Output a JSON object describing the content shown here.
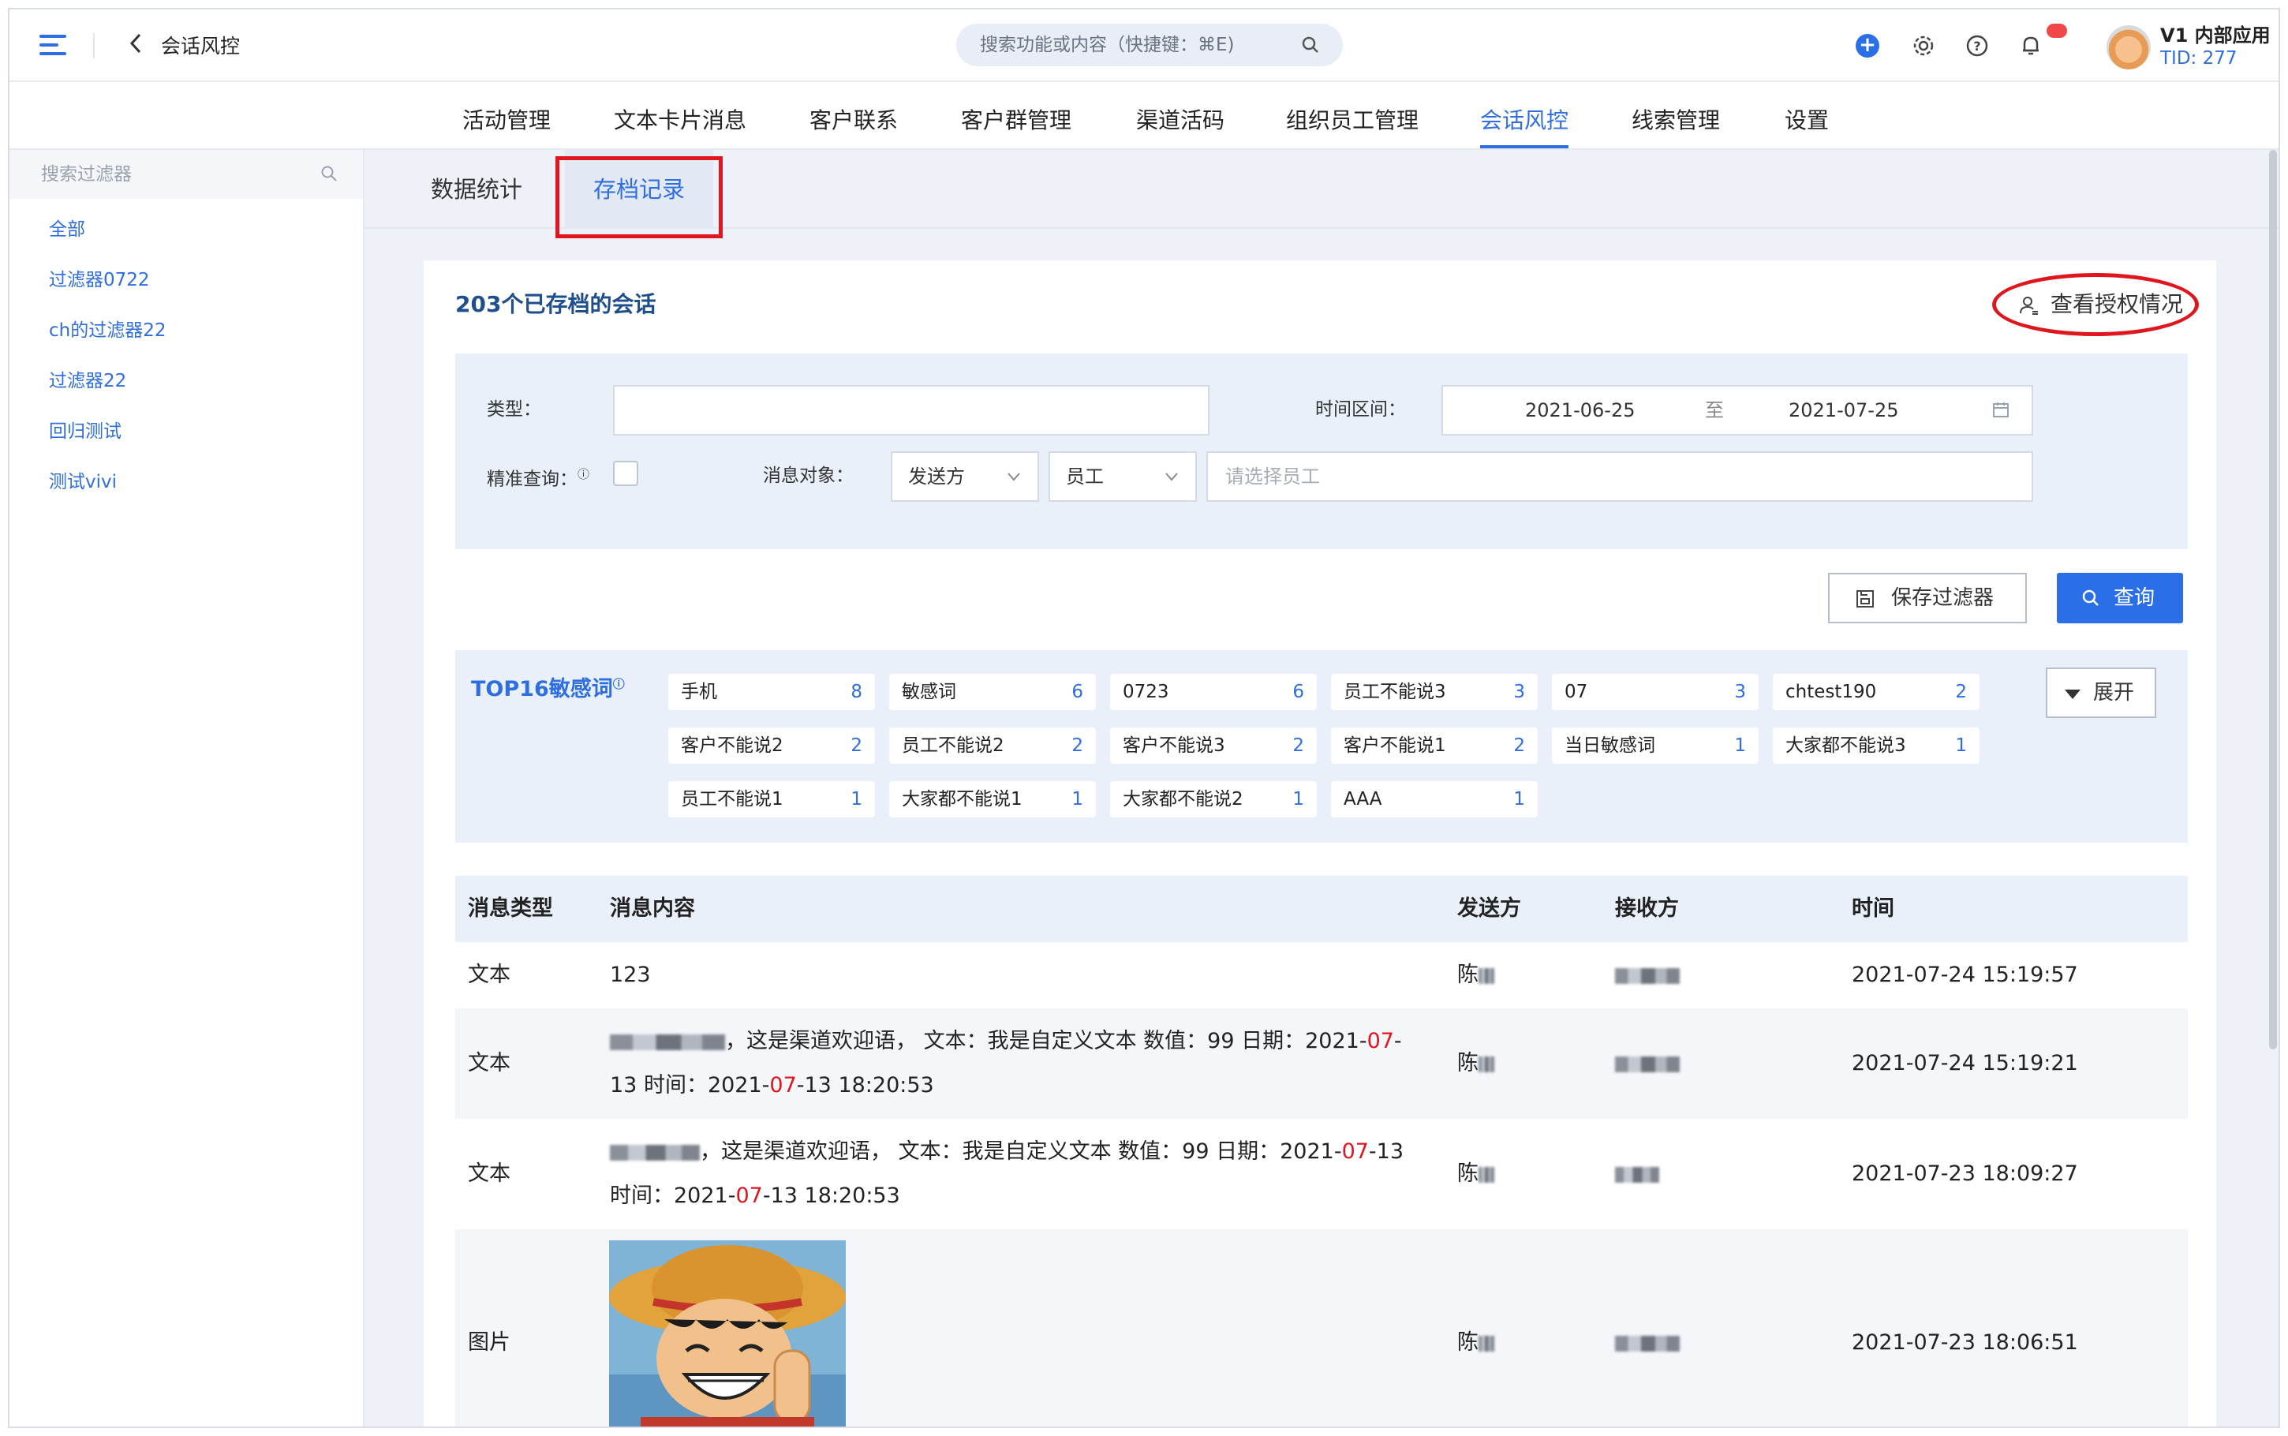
{
  "topbar": {
    "page_title": "会话风控",
    "search_placeholder": "搜索功能或内容（快捷键：⌘E)",
    "app_name": "V1 内部应用",
    "tid": "TID: 277"
  },
  "nav": {
    "items": [
      "活动管理",
      "文本卡片消息",
      "客户联系",
      "客户群管理",
      "渠道活码",
      "组织员工管理",
      "会话风控",
      "线索管理",
      "设置"
    ],
    "active": "会话风控"
  },
  "sidebar": {
    "search_placeholder": "搜索过滤器",
    "items": [
      "全部",
      "过滤器0722",
      "ch的过滤器22",
      "过滤器22",
      "回归测试",
      "测试vivi"
    ]
  },
  "tabs": [
    "数据统计",
    "存档记录"
  ],
  "card": {
    "title": "203个已存档的会话",
    "auth_link": "查看授权情况"
  },
  "filter": {
    "type_label": "类型：",
    "time_label": "时间区间：",
    "start_date": "2021-06-25",
    "range_sep": "至",
    "end_date": "2021-07-25",
    "exact_label": "精准查询：",
    "target_label": "消息对象：",
    "sender_select": "发送方",
    "role_select": "员工",
    "employee_placeholder": "请选择员工"
  },
  "buttons": {
    "save_filter": "保存过滤器",
    "query": "查询",
    "expand": "展开"
  },
  "top_words": {
    "title": "TOP16敏感词",
    "items": [
      {
        "word": "手机",
        "count": "8"
      },
      {
        "word": "敏感词",
        "count": "6"
      },
      {
        "word": "0723",
        "count": "6"
      },
      {
        "word": "员工不能说3",
        "count": "3"
      },
      {
        "word": "07",
        "count": "3"
      },
      {
        "word": "chtest190",
        "count": "2"
      },
      {
        "word": "客户不能说2",
        "count": "2"
      },
      {
        "word": "员工不能说2",
        "count": "2"
      },
      {
        "word": "客户不能说3",
        "count": "2"
      },
      {
        "word": "客户不能说1",
        "count": "2"
      },
      {
        "word": "当日敏感词",
        "count": "1"
      },
      {
        "word": "大家都不能说3",
        "count": "1"
      },
      {
        "word": "员工不能说1",
        "count": "1"
      },
      {
        "word": "大家都不能说1",
        "count": "1"
      },
      {
        "word": "大家都不能说2",
        "count": "1"
      },
      {
        "word": "AAA",
        "count": "1"
      }
    ]
  },
  "table": {
    "headers": [
      "消息类型",
      "消息内容",
      "发送方",
      "接收方",
      "时间"
    ],
    "rows": [
      {
        "type": "文本",
        "content": "123",
        "sender": "陈",
        "time": "2021-07-24 15:19:57"
      },
      {
        "type": "文本",
        "content_a": "，这是渠道欢迎语，  文本：我是自定义文本 数值：99 日期：2021-",
        "content_red1": "07",
        "content_b": "-",
        "content_c": "13 时间：2021-",
        "content_red2": "07",
        "content_d": "-13 18:20:53",
        "sender": "陈",
        "time": "2021-07-24 15:19:21"
      },
      {
        "type": "文本",
        "content_a": "，这是渠道欢迎语，  文本：我是自定义文本 数值：99 日期：2021-",
        "content_red1": "07",
        "content_b": "-13",
        "content_c": "时间：2021-",
        "content_red2": "07",
        "content_d": "-13 18:20:53",
        "sender": "陈",
        "time": "2021-07-23 18:09:27"
      },
      {
        "type": "图片",
        "sender": "陈",
        "time": "2021-07-23 18:06:51"
      }
    ]
  },
  "colors": {
    "accent": "#2f6ee0",
    "highlight": "#e0161e"
  }
}
